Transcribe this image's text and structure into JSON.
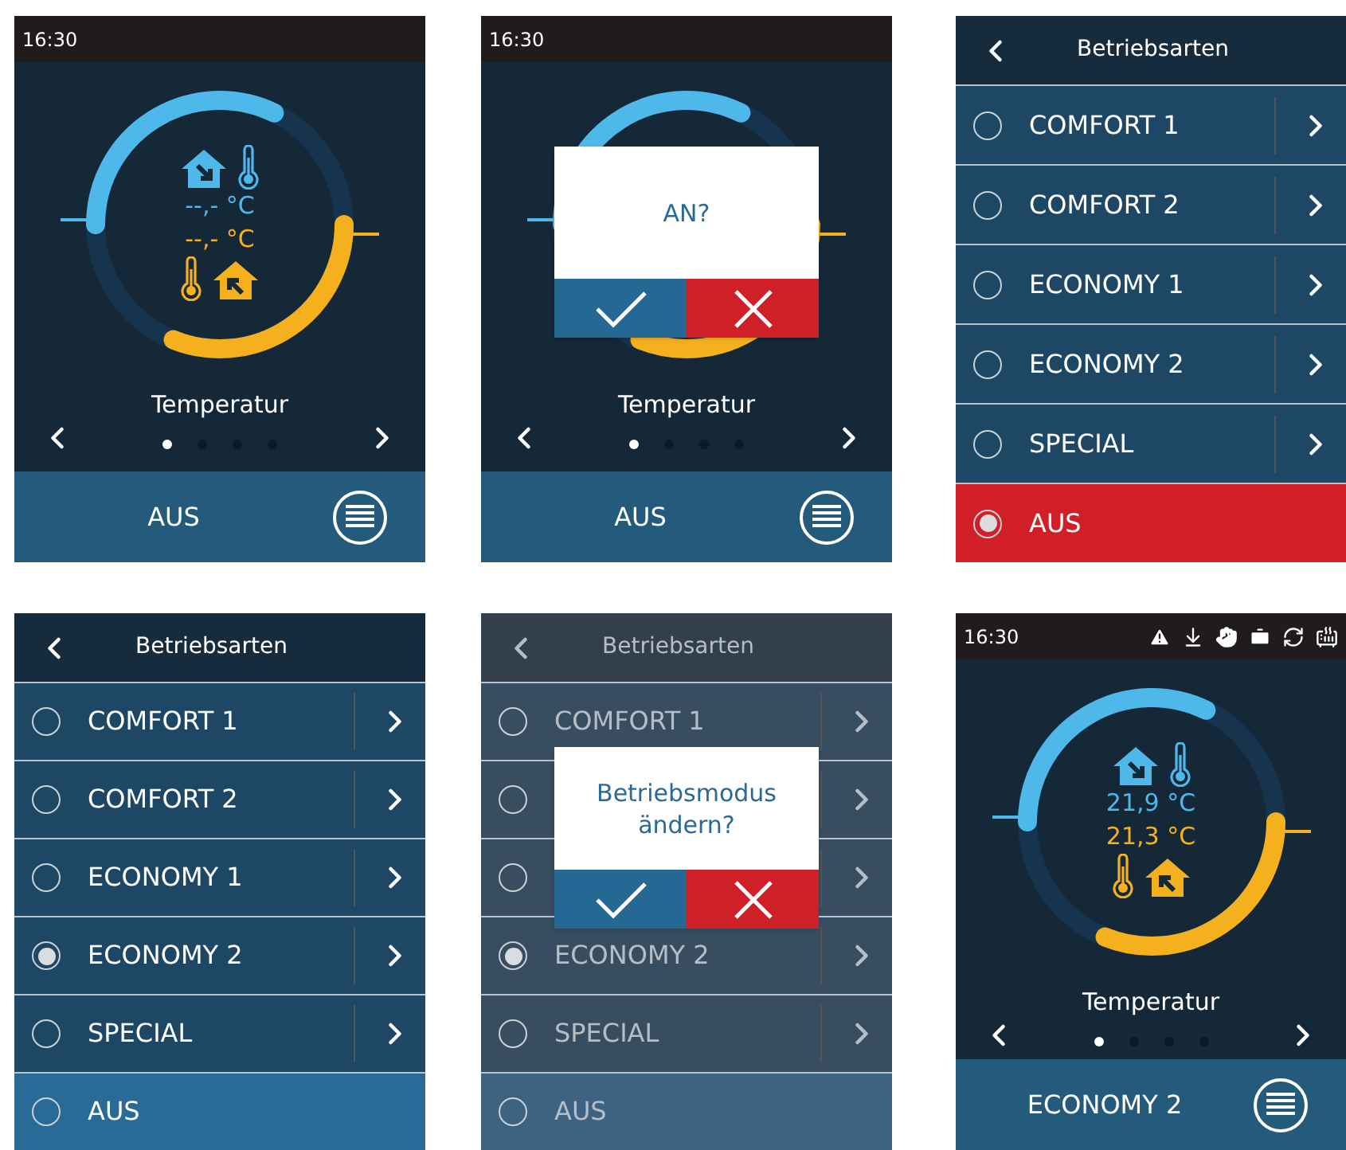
{
  "screens": [
    {
      "kind": "dashboard",
      "time": "16:30",
      "status_icons": false,
      "readings": [
        {
          "text": "--,- °C",
          "color": "#4fb8ea"
        },
        {
          "text": "--,- °C",
          "color": "#f5b01e"
        }
      ],
      "caption": "Temperatur",
      "pages": [
        {
          "selected": true
        },
        {
          "selected": false
        },
        {
          "selected": false
        },
        {
          "selected": false
        }
      ],
      "mode": "AUS"
    },
    {
      "kind": "dashboard",
      "time": "16:30",
      "status_icons": false,
      "caption": "Temperatur",
      "pages": [
        {
          "selected": true
        },
        {
          "selected": false
        },
        {
          "selected": false
        },
        {
          "selected": false
        }
      ],
      "mode": "AUS",
      "dialog": {
        "text": "AN?"
      }
    },
    {
      "kind": "modes",
      "title": "Betriebsarten",
      "dimmed": false,
      "items": [
        {
          "label": "COMFORT 1",
          "kind": "mode",
          "selected": false
        },
        {
          "label": "COMFORT 2",
          "kind": "mode",
          "selected": false
        },
        {
          "label": "ECONOMY 1",
          "kind": "mode",
          "selected": false
        },
        {
          "label": "ECONOMY 2",
          "kind": "mode",
          "selected": false
        },
        {
          "label": "SPECIAL",
          "kind": "mode",
          "selected": false
        },
        {
          "label": "AUS",
          "kind": "off",
          "selected": true
        }
      ]
    },
    {
      "kind": "modes",
      "title": "Betriebsarten",
      "dimmed": false,
      "items": [
        {
          "label": "COMFORT 1",
          "kind": "mode",
          "selected": false
        },
        {
          "label": "COMFORT 2",
          "kind": "mode",
          "selected": false
        },
        {
          "label": "ECONOMY 1",
          "kind": "mode",
          "selected": false
        },
        {
          "label": "ECONOMY 2",
          "kind": "mode",
          "selected": true
        },
        {
          "label": "SPECIAL",
          "kind": "mode",
          "selected": false
        },
        {
          "label": "AUS",
          "kind": "off",
          "selected": false
        }
      ]
    },
    {
      "kind": "modes",
      "title": "Betriebsarten",
      "dimmed": true,
      "items": [
        {
          "label": "COMFORT 1",
          "kind": "mode",
          "selected": false
        },
        {
          "kind": "mode",
          "selected": false
        },
        {
          "kind": "mode",
          "selected": false
        },
        {
          "label": "ECONOMY 2",
          "kind": "mode",
          "selected": true
        },
        {
          "label": "SPECIAL",
          "kind": "mode",
          "selected": false
        },
        {
          "label": "AUS",
          "kind": "off",
          "selected": false
        }
      ],
      "dialog": {
        "text": "Betriebsmodus ändern?"
      }
    },
    {
      "kind": "dashboard",
      "time": "16:30",
      "status_icons": true,
      "readings": [
        {
          "text": "21,9 °C",
          "color": "#4fb8ea"
        },
        {
          "text": "21,3 °C",
          "color": "#f5b01e"
        }
      ],
      "caption": "Temperatur",
      "pages": [
        {
          "selected": true
        },
        {
          "selected": false
        },
        {
          "selected": false
        },
        {
          "selected": false
        }
      ],
      "mode": "ECONOMY 2"
    }
  ]
}
